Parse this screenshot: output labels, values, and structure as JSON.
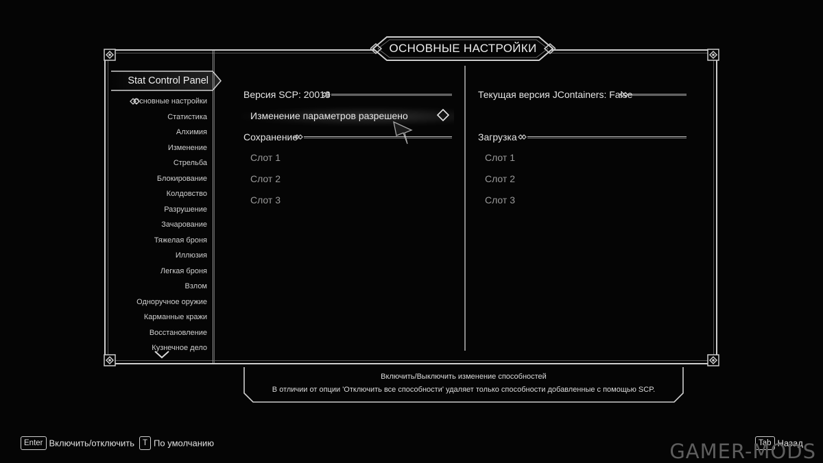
{
  "window_title": "ОСНОВНЫЕ НАСТРОЙКИ",
  "sidebar": {
    "selected_mod": "Stat Control Panel",
    "items": [
      {
        "label": "Основные настройки",
        "active": true
      },
      {
        "label": "Статистика"
      },
      {
        "label": "Алхимия"
      },
      {
        "label": "Изменение"
      },
      {
        "label": "Стрельба"
      },
      {
        "label": "Блокирование"
      },
      {
        "label": "Колдовство"
      },
      {
        "label": "Разрушение"
      },
      {
        "label": "Зачарование"
      },
      {
        "label": "Тяжелая броня"
      },
      {
        "label": "Иллюзия"
      },
      {
        "label": "Легкая броня"
      },
      {
        "label": "Взлом"
      },
      {
        "label": "Одноручное оружие"
      },
      {
        "label": "Карманные кражи"
      },
      {
        "label": "Восстановление"
      },
      {
        "label": "Кузнечное дело"
      }
    ]
  },
  "left_column": {
    "header_version": "Версия SCP: 20013",
    "toggle_option": {
      "label": "Изменение параметров разрешено",
      "state": "enabled"
    },
    "header_save": "Сохранение",
    "save_slots": [
      "Слот 1",
      "Слот 2",
      "Слот 3"
    ]
  },
  "right_column": {
    "header_jcontainers": "Текущая версия JContainers: False",
    "header_load": "Загрузка",
    "load_slots": [
      "Слот 1",
      "Слот 2",
      "Слот 3"
    ]
  },
  "info": {
    "line1": "Включить/Выключить изменение способностей",
    "line2": "В отличии от опции 'Отключить все способности' удаляет только способности добавленные с помощью SCP."
  },
  "hints": {
    "enter_key": "Enter",
    "enter_label": "Включить/отключить",
    "t_key": "T",
    "t_label": "По умолчанию",
    "tab_key": "Tab",
    "tab_label": "Назад"
  },
  "watermark": "GAMER-MODS",
  "colors": {
    "background": "#050505",
    "frame": "#cfcfcf",
    "text": "#d8d8d8",
    "muted": "#9a9a9a"
  }
}
